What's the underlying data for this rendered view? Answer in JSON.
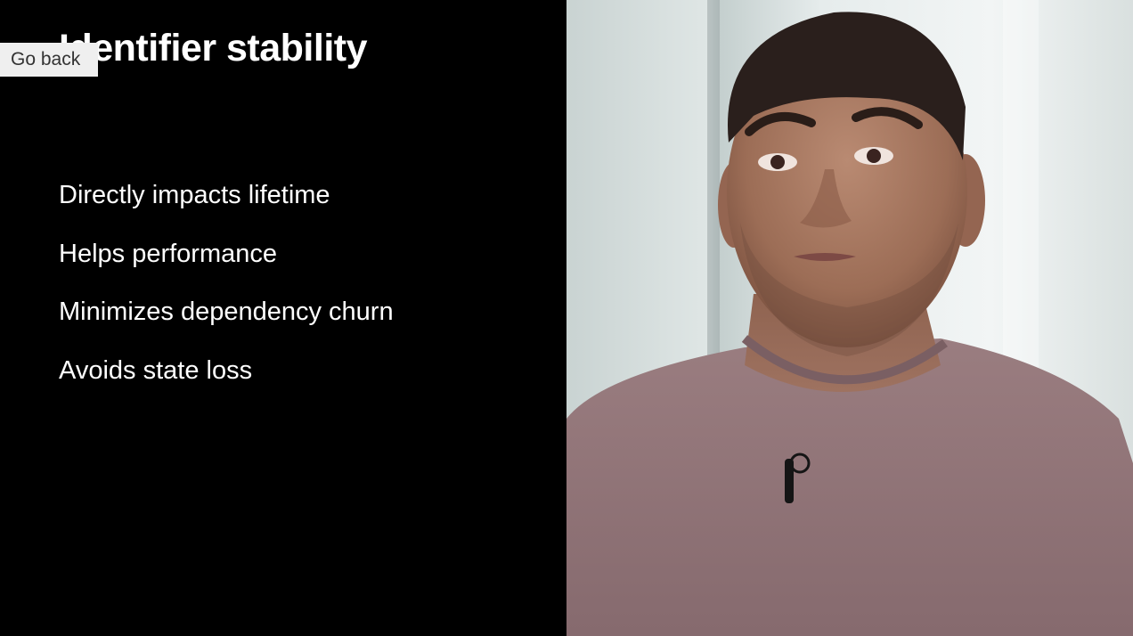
{
  "slide": {
    "title": "Identifier stability",
    "bullets": [
      "Directly impacts lifetime",
      "Helps performance",
      "Minimizes dependency churn",
      "Avoids state loss"
    ]
  },
  "controls": {
    "go_back_label": "Go back"
  },
  "colors": {
    "slide_background": "#000000",
    "slide_text": "#ffffff",
    "button_background": "#efefef"
  }
}
